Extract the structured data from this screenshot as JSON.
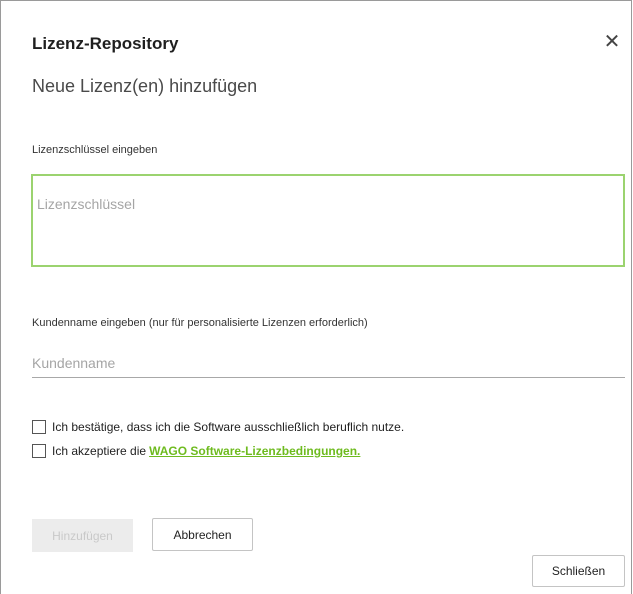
{
  "dialog": {
    "title": "Lizenz-Repository",
    "close_icon": "close-icon",
    "subtitle": "Neue Lizenz(en) hinzufügen"
  },
  "license_key": {
    "label": "Lizenzschlüssel eingeben",
    "value": "",
    "placeholder": "Lizenzschlüssel"
  },
  "customer_name": {
    "label": "Kundenname eingeben (nur für personalisierte Lizenzen erforderlich)",
    "value": "",
    "placeholder": "Kundenname"
  },
  "checkboxes": [
    {
      "label": "Ich bestätige, dass ich die Software ausschließlich beruflich nutze.",
      "checked": false
    },
    {
      "label_prefix": "Ich akzeptiere die",
      "link_text": "WAGO Software-Lizenzbedingungen.",
      "checked": false
    }
  ],
  "buttons": {
    "add": "Hinzufügen",
    "add_enabled": false,
    "cancel": "Abbrechen",
    "close": "Schließen"
  },
  "colors": {
    "accent": "#6ebb1f",
    "focus_border": "#9bd36f",
    "disabled_bg": "#ececec",
    "disabled_text": "#c9c9c9"
  }
}
